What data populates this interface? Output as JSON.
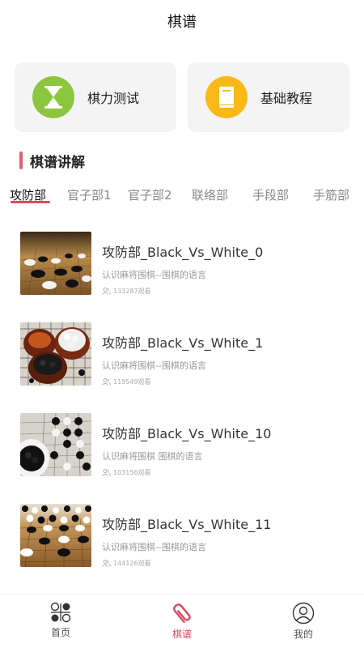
{
  "header": {
    "title": "棋谱"
  },
  "quick": [
    {
      "label": "棋力测试",
      "icon": "hourglass-icon",
      "color": "#8cc63f"
    },
    {
      "label": "基础教程",
      "icon": "book-icon",
      "color": "#f8b818"
    }
  ],
  "section": {
    "title": "棋谱讲解",
    "accent": "#e06070"
  },
  "tabs": [
    {
      "label": "攻防部"
    },
    {
      "label": "官子部1"
    },
    {
      "label": "官子部2"
    },
    {
      "label": "联络部"
    },
    {
      "label": "手段部"
    },
    {
      "label": "手筋部"
    }
  ],
  "items": [
    {
      "title": "攻防部_Black_Vs_White_0",
      "desc": "认识麻将围棋--围棋的语言",
      "views": "133287观看"
    },
    {
      "title": "攻防部_Black_Vs_White_1",
      "desc": "认识麻将围棋--围棋的语言",
      "views": "119549观看"
    },
    {
      "title": "攻防部_Black_Vs_White_10",
      "desc": "认识麻将围棋 围棋的语言",
      "views": "103156观看"
    },
    {
      "title": "攻防部_Black_Vs_White_11",
      "desc": "认识麻将围棋--围棋的语言",
      "views": "144126观看"
    }
  ],
  "nav": [
    {
      "label": "首页",
      "icon": "go-stones-icon"
    },
    {
      "label": "棋谱",
      "icon": "paperclip-icon"
    },
    {
      "label": "我的",
      "icon": "user-icon"
    }
  ],
  "colors": {
    "active_tab": "#111111",
    "underline": "#e0485e",
    "nav_active": "#e0485e"
  }
}
